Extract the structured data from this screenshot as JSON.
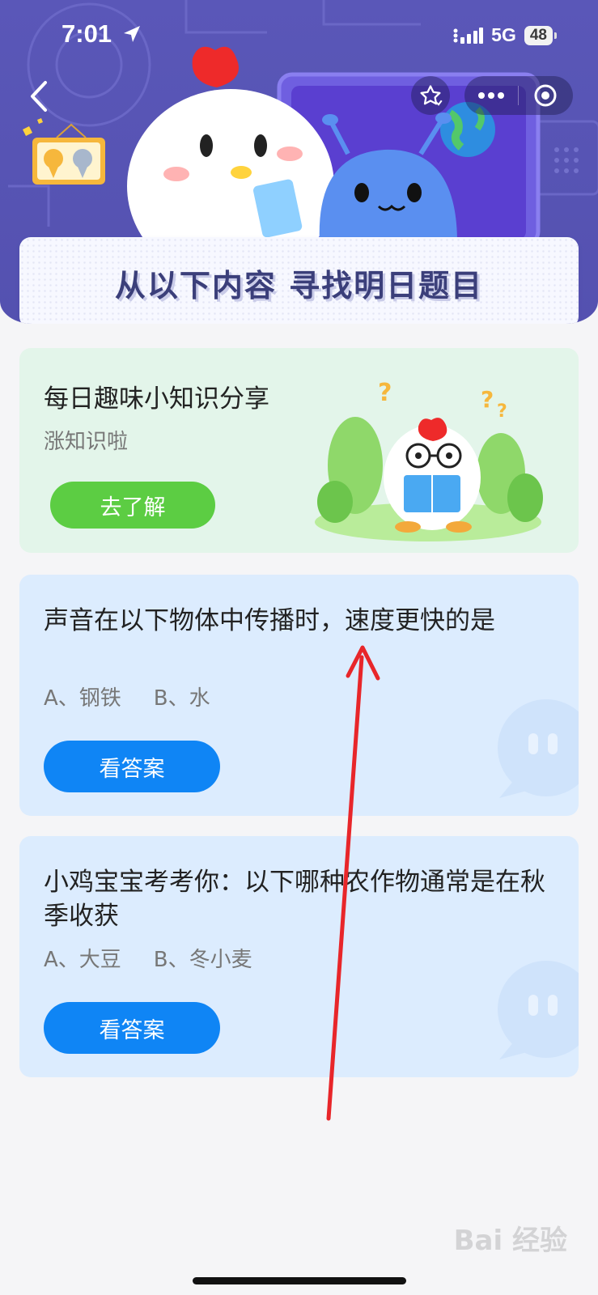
{
  "status_bar": {
    "time": "7:01",
    "network": "5G",
    "battery": "48"
  },
  "banner": {
    "title": "从以下内容 寻找明日题目"
  },
  "knowledge_card": {
    "title": "每日趣味小知识分享",
    "subtitle": "涨知识啦",
    "button_label": "去了解"
  },
  "questions": [
    {
      "title": "声音在以下物体中传播时，速度更快的是",
      "options": [
        "A、钢铁",
        "B、水"
      ],
      "button_label": "看答案"
    },
    {
      "title": "小鸡宝宝考考你：以下哪种农作物通常是在秋季收获",
      "options": [
        "A、大豆",
        "B、冬小麦"
      ],
      "button_label": "看答案"
    }
  ],
  "watermark": "Bai 经验",
  "colors": {
    "header": "#5a57b8",
    "knowledge_bg": "#e3f5ea",
    "question_bg": "#dcecfe",
    "green_button": "#5ccd43",
    "blue_button": "#0f85f5",
    "arrow": "#e8262a"
  },
  "icons": [
    "location-arrow-icon",
    "signal-icon",
    "back-chevron-icon",
    "star-icon",
    "more-dots-icon",
    "close-circle-icon",
    "medal-icon",
    "chat-bubble-icon"
  ]
}
